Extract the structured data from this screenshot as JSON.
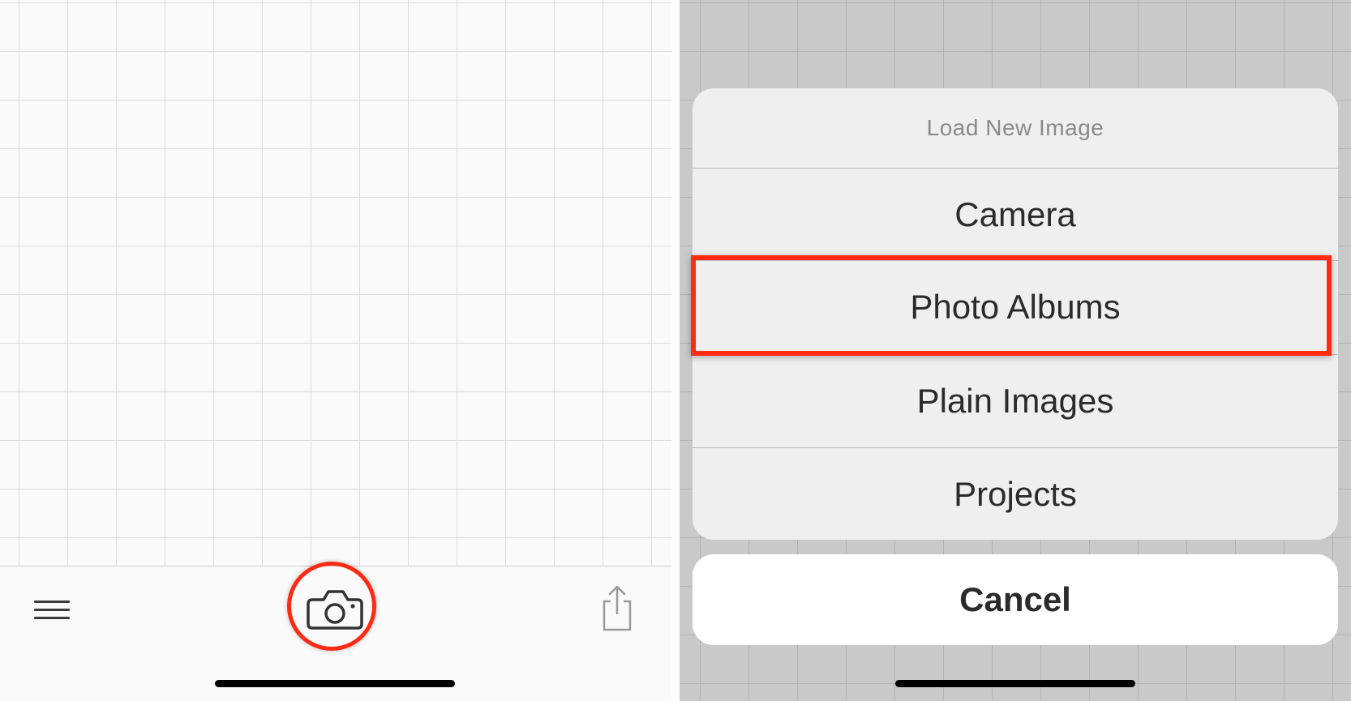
{
  "left_screen": {
    "toolbar": {
      "menu_icon": "hamburger-menu-icon",
      "camera_icon": "camera-icon",
      "share_icon": "share-icon"
    },
    "annotation_color": "#ff2a12"
  },
  "right_screen": {
    "action_sheet": {
      "title": "Load New Image",
      "options": [
        {
          "label": "Camera"
        },
        {
          "label": "Photo Albums"
        },
        {
          "label": "Plain Images"
        },
        {
          "label": "Projects"
        }
      ],
      "cancel_label": "Cancel"
    },
    "highlighted_option": "Photo Albums",
    "annotation_color": "#ff2a12"
  }
}
